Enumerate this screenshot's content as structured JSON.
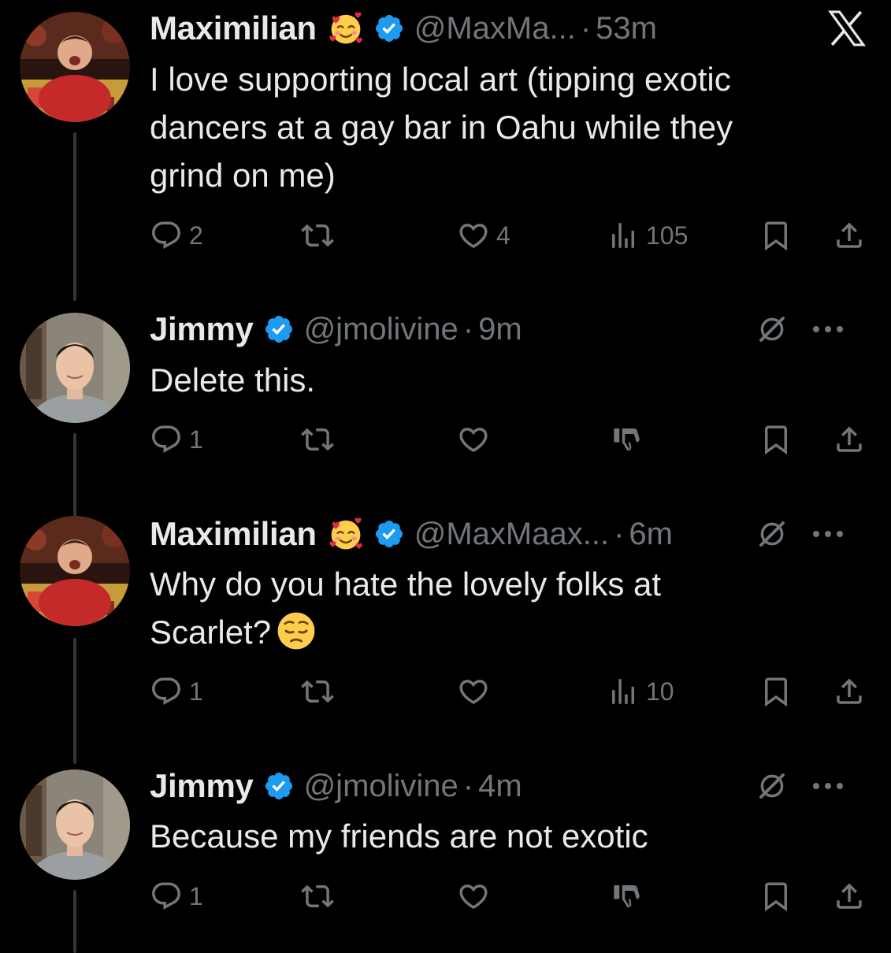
{
  "theme": {
    "background": "#000000",
    "text": "#e7e9ea",
    "muted": "#71767b",
    "verified": "#1d9bf0",
    "thread_line": "#333639"
  },
  "app": {
    "logo_icon": "x-logo-icon"
  },
  "tweets": [
    {
      "name": "Maximilian",
      "name_emoji": "smiling-face-with-hearts",
      "handle": "@MaxMa...",
      "dot": "·",
      "time": "53m",
      "text_lines": [
        "I love supporting local art (tipping exotic",
        "dancers at a gay bar in Oahu while they",
        "grind on me)"
      ],
      "reply_count": "2",
      "retweet_count": "",
      "like_count": "4",
      "view_count": "105"
    },
    {
      "name": "Jimmy",
      "handle": "@jmolivine",
      "dot": "·",
      "time": "9m",
      "text_lines": [
        "Delete this."
      ],
      "reply_count": "1",
      "retweet_count": "",
      "like_count": ""
    },
    {
      "name": "Maximilian",
      "name_emoji": "smiling-face-with-hearts",
      "handle": "@MaxMaax...",
      "dot": "·",
      "time": "6m",
      "text_lines": [
        "Why do you hate the lovely folks at",
        "Scarlet?"
      ],
      "trailing_emoji": "pensive-face",
      "reply_count": "1",
      "retweet_count": "",
      "like_count": "",
      "view_count": "10"
    },
    {
      "name": "Jimmy",
      "handle": "@jmolivine",
      "dot": "·",
      "time": "4m",
      "text_lines": [
        "Because my friends are not exotic"
      ],
      "reply_count": "1",
      "retweet_count": "",
      "like_count": ""
    }
  ]
}
